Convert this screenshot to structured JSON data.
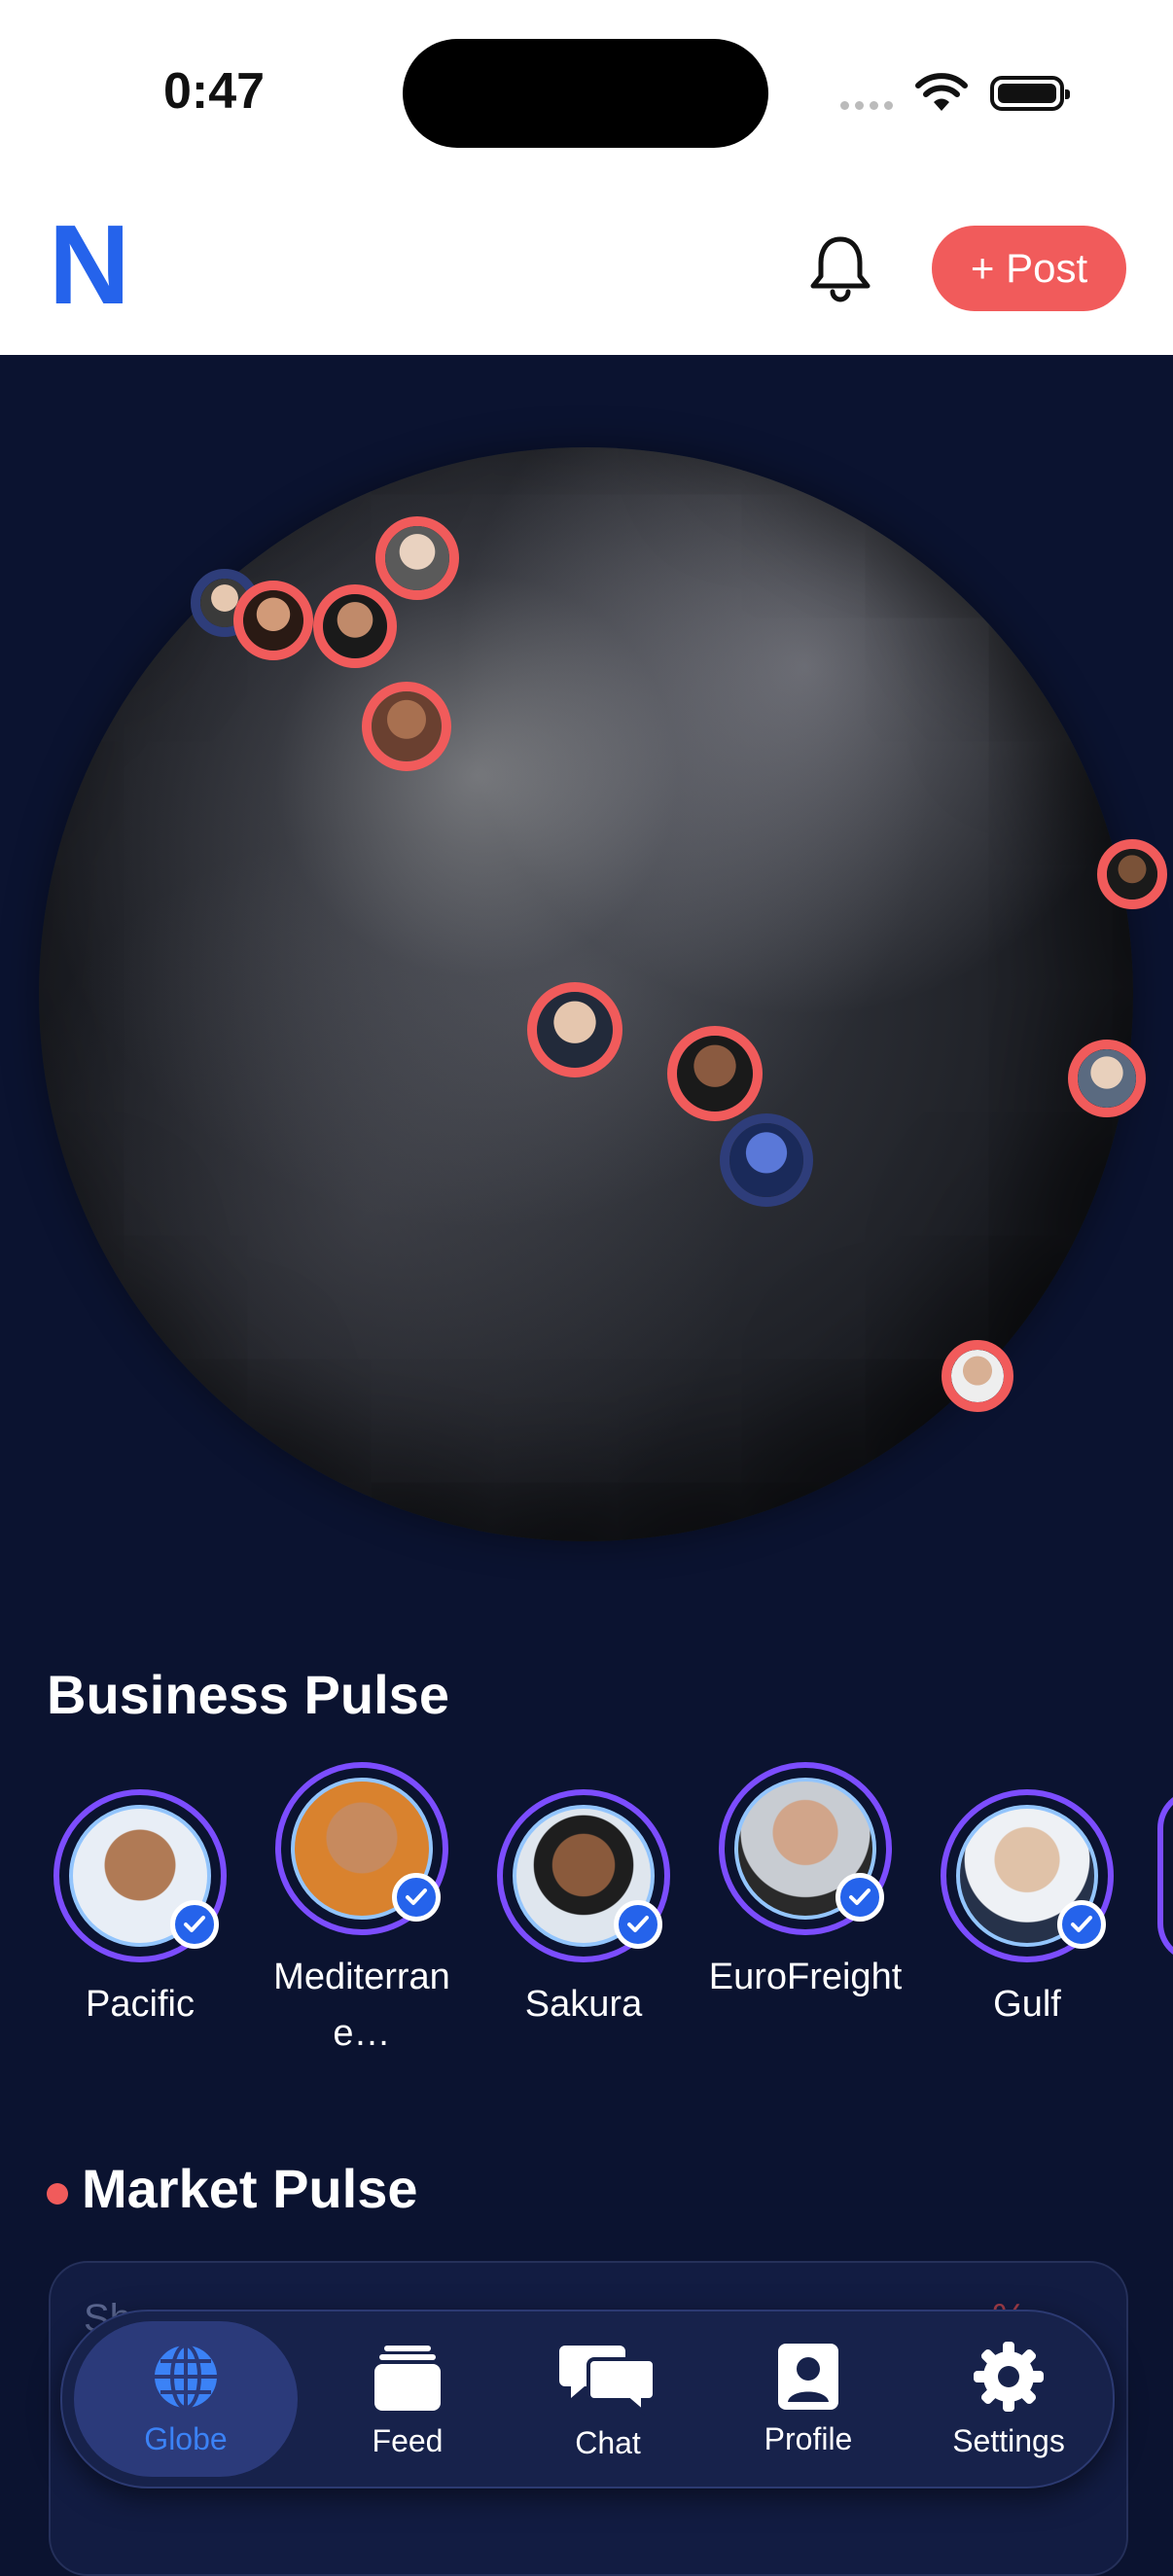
{
  "status_bar": {
    "time": "0:47"
  },
  "header": {
    "logo": "N",
    "post_button": "+ Post"
  },
  "business_pulse": {
    "title": "Business Pulse",
    "stories": [
      {
        "label": "Pacific",
        "skin": "#b07a55"
      },
      {
        "label": "Mediterrane…",
        "skin": "#c78a5e"
      },
      {
        "label": "Sakura",
        "skin": "#8a5a3c"
      },
      {
        "label": "EuroFreight",
        "skin": "#d1a58a"
      },
      {
        "label": "Gulf",
        "skin": "#e0c2a8"
      }
    ]
  },
  "market_pulse": {
    "title": "Market Pulse",
    "row_label": "Sh",
    "row_pct": "%"
  },
  "tabbar": {
    "tabs": [
      {
        "label": "Globe",
        "active": true
      },
      {
        "label": "Feed",
        "active": false
      },
      {
        "label": "Chat",
        "active": false
      },
      {
        "label": "Profile",
        "active": false
      },
      {
        "label": "Settings",
        "active": false
      }
    ]
  },
  "colors": {
    "accent": "#f15b5b",
    "brand": "#2563eb",
    "background": "#0b1330"
  }
}
